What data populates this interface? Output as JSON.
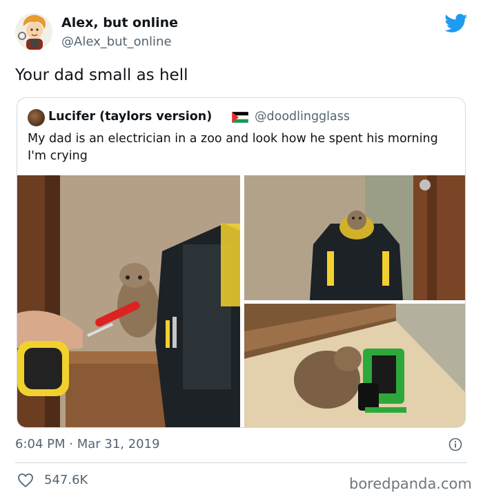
{
  "author": {
    "name": "Alex, but online",
    "handle": "@Alex_but_online"
  },
  "tweet": {
    "text": "Your dad small as hell",
    "timestamp": "6:04 PM · Mar 31, 2019",
    "likes": "547.6K"
  },
  "quoted": {
    "name": "Lucifer (taylors version)",
    "handle": "@doodlingglass",
    "text": "My dad is an electrician in a zoo and look how he spent his morning I'm crying"
  },
  "watermark": "boredpanda.com",
  "colors": {
    "brand": "#1d9bf0",
    "muted": "#536471",
    "border": "#cfd9de"
  },
  "icons": [
    "twitter-bird-icon",
    "info-icon",
    "heart-icon",
    "palestine-flag-icon"
  ]
}
